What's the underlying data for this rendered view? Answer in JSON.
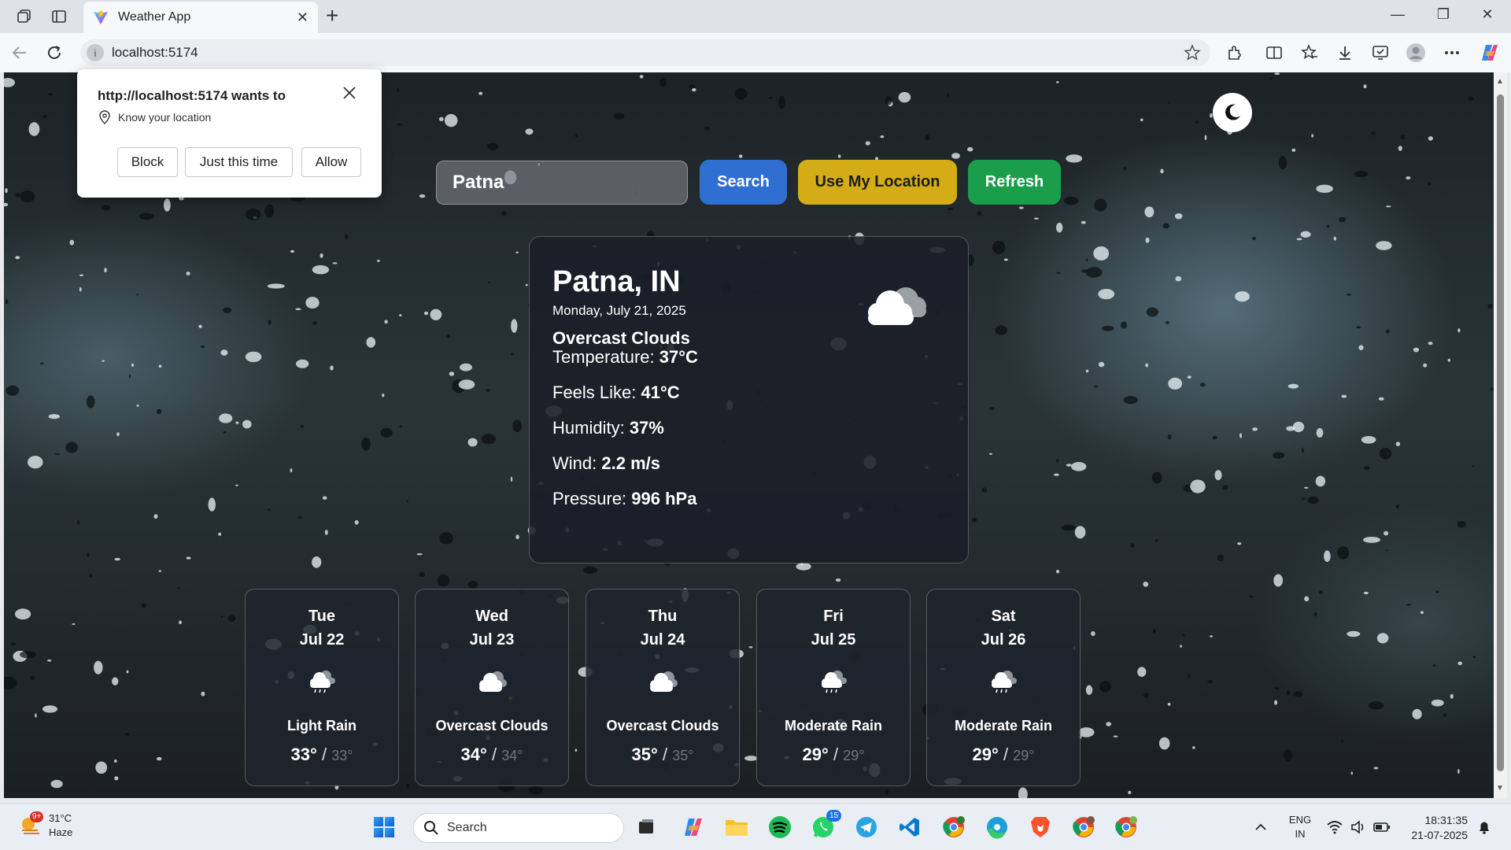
{
  "browser": {
    "tab_title": "Weather App",
    "url": "localhost:5174"
  },
  "permission_popup": {
    "message": "http://localhost:5174 wants to",
    "permission": "Know your location",
    "buttons": [
      "Block",
      "Just this time",
      "Allow"
    ]
  },
  "search": {
    "value": "Patna",
    "search_label": "Search",
    "location_label": "Use My Location",
    "refresh_label": "Refresh"
  },
  "current": {
    "city": "Patna, IN",
    "date": "Monday, July 21, 2025",
    "condition": "Overcast Clouds",
    "stats": [
      {
        "label": "Temperature:",
        "value": "37°C"
      },
      {
        "label": "Feels Like:",
        "value": "41°C"
      },
      {
        "label": "Humidity:",
        "value": "37%"
      },
      {
        "label": "Wind:",
        "value": "2.2 m/s"
      },
      {
        "label": "Pressure:",
        "value": "996 hPa"
      }
    ]
  },
  "forecast": [
    {
      "day": "Tue",
      "date": "Jul 22",
      "condition": "Light Rain",
      "high": "33°",
      "low": "33°",
      "icon": "rain-cloud-icon"
    },
    {
      "day": "Wed",
      "date": "Jul 23",
      "condition": "Overcast Clouds",
      "high": "34°",
      "low": "34°",
      "icon": "cloud-icon"
    },
    {
      "day": "Thu",
      "date": "Jul 24",
      "condition": "Overcast Clouds",
      "high": "35°",
      "low": "35°",
      "icon": "cloud-icon"
    },
    {
      "day": "Fri",
      "date": "Jul 25",
      "condition": "Moderate Rain",
      "high": "29°",
      "low": "29°",
      "icon": "rain-cloud-icon"
    },
    {
      "day": "Sat",
      "date": "Jul 26",
      "condition": "Moderate Rain",
      "high": "29°",
      "low": "29°",
      "icon": "rain-cloud-icon"
    }
  ],
  "taskbar": {
    "weather_badge": "9+",
    "weather_temp": "31°C",
    "weather_desc": "Haze",
    "search_placeholder": "Search",
    "whatsapp_badge": "15",
    "lang_top": "ENG",
    "lang_bottom": "IN",
    "time": "18:31:35",
    "date": "21-07-2025"
  },
  "colors": {
    "search_button": "#2f6fd1",
    "location_button": "#d4ac15",
    "refresh_button": "#1b9e4b"
  }
}
